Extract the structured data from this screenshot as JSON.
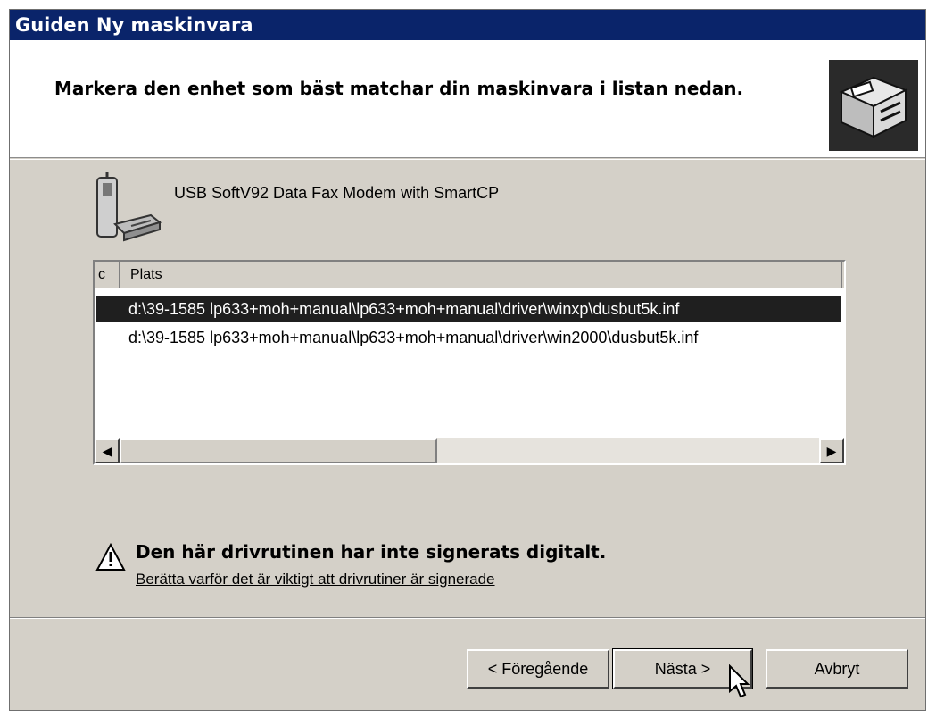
{
  "window": {
    "title": "Guiden Ny maskinvara"
  },
  "header": {
    "instruction": "Markera den enhet som bäst matchar din maskinvara i listan nedan.",
    "icon": "hardware-wizard-icon"
  },
  "device": {
    "name": "USB SoftV92 Data Fax Modem with SmartCP",
    "icon": "modem-device-icon"
  },
  "list": {
    "columns": [
      "c",
      "Plats"
    ],
    "rows": [
      {
        "path": "d:\\39-1585 lp633+moh+manual\\lp633+moh+manual\\driver\\winxp\\dusbut5k.inf",
        "selected": true
      },
      {
        "path": "d:\\39-1585 lp633+moh+manual\\lp633+moh+manual\\driver\\win2000\\dusbut5k.inf",
        "selected": false
      }
    ],
    "scroll_left_icon": "arrow-left-icon",
    "scroll_right_icon": "arrow-right-icon"
  },
  "warning": {
    "text": "Den här drivrutinen har inte signerats digitalt.",
    "link": "Berätta varför det är viktigt att drivrutiner är signerade",
    "icon": "warning-icon"
  },
  "buttons": {
    "back": "< Föregående",
    "next": "Nästa >",
    "cancel": "Avbryt"
  },
  "colors": {
    "titlebar": "#0a246a",
    "dialog": "#d4d0c8",
    "selection": "#1f1f1f"
  }
}
